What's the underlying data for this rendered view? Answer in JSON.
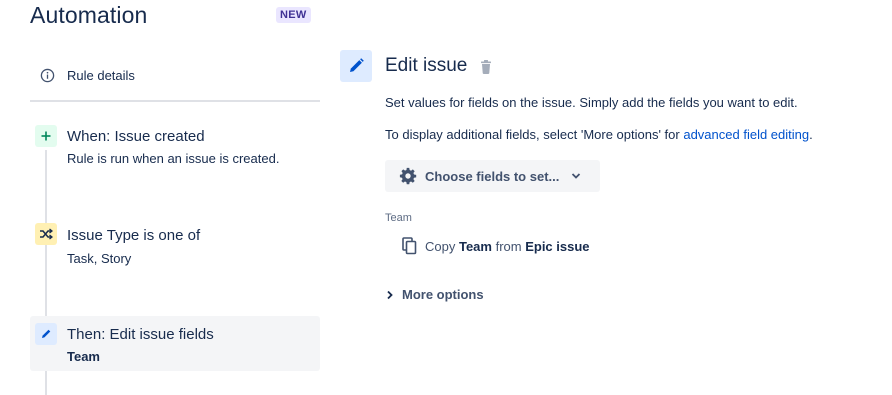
{
  "header": {
    "title": "Automation",
    "badge": "NEW"
  },
  "sidebar": {
    "rule_details": {
      "icon": "info-icon",
      "label": "Rule details"
    },
    "steps": [
      {
        "icon": "plus-icon",
        "icon_bg": "#e3fcef",
        "icon_color": "#00875a",
        "title": "When: Issue created",
        "subtitle": "Rule is run when an issue is created."
      },
      {
        "icon": "branch-icon",
        "icon_bg": "#fff0b3",
        "icon_color": "#172b4d",
        "title": "Issue Type is one of",
        "subtitle": "Task, Story"
      },
      {
        "icon": "pencil-icon",
        "icon_bg": "#deebff",
        "icon_color": "#0052cc",
        "title": "Then: Edit issue fields",
        "subtitle": "Team"
      }
    ]
  },
  "main": {
    "title": "Edit issue",
    "description_1": "Set values for fields on the issue. Simply add the fields you want to edit.",
    "description_2_prefix": "To display additional fields, select 'More options' for ",
    "description_2_link": "advanced field editing",
    "description_2_suffix": ".",
    "choose_button": "Choose fields to set...",
    "field": {
      "label": "Team",
      "copy_prefix": "Copy ",
      "copy_field": "Team",
      "copy_mid": " from ",
      "copy_source": "Epic issue"
    },
    "more_options": "More options"
  },
  "colors": {
    "accent": "#0052cc",
    "text": "#172b4d",
    "muted": "#5e6c84",
    "badge_bg": "#eae6ff"
  }
}
